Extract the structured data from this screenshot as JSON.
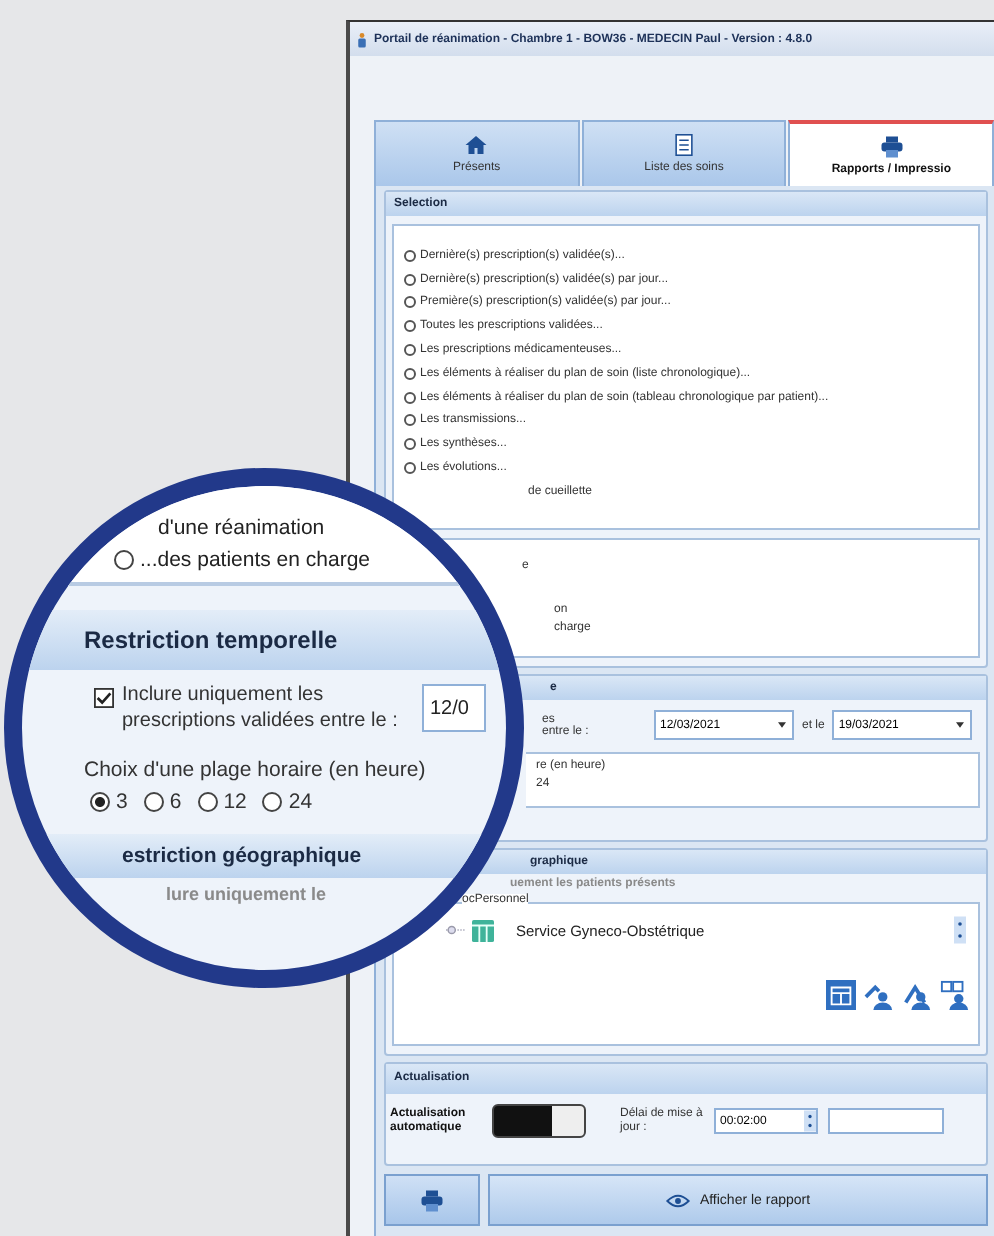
{
  "window": {
    "title": "Portail de réanimation - Chambre 1 - BOW36 - MEDECIN Paul - Version : 4.8.0"
  },
  "tabs": [
    {
      "label": "Présents",
      "selected": false
    },
    {
      "label": "Liste des soins",
      "selected": false
    },
    {
      "label": "Rapports / Impressio",
      "selected": true
    }
  ],
  "selection": {
    "header": "Selection",
    "options": [
      {
        "kind": "full",
        "label": "Dernière(s) prescription(s) validée(s)...",
        "selected": false
      },
      {
        "kind": "full",
        "label": "Dernière(s) prescription(s) validée(s) par jour...",
        "selected": false
      },
      {
        "kind": "full",
        "label": "Première(s) prescription(s) validée(s) par jour...",
        "selected": false
      },
      {
        "kind": "full",
        "label": "Toutes les prescriptions validées...",
        "selected": false
      },
      {
        "kind": "full",
        "label": "Les prescriptions médicamenteuses...",
        "selected": false
      },
      {
        "kind": "full",
        "label": "Les éléments à réaliser du plan de soin (liste chronologique)...",
        "selected": false
      },
      {
        "kind": "full",
        "label": "Les éléments à réaliser du plan de soin (tableau chronologique par patient)...",
        "selected": false
      },
      {
        "kind": "full",
        "label": "Les transmissions...",
        "selected": false
      },
      {
        "kind": "full",
        "label": "Les synthèses...",
        "selected": false
      },
      {
        "kind": "full",
        "label": "Les évolutions...",
        "selected": false
      },
      {
        "kind": "partial",
        "label": "de cueillette"
      }
    ],
    "scope_fragments": [
      "e",
      "on",
      "charge"
    ]
  },
  "temporal": {
    "header_fragment": "e",
    "label_fragments": [
      "es",
      "entre le :"
    ],
    "date_from": "12/03/2021",
    "and_label": "et le",
    "date_to": "19/03/2021",
    "range_fragment": "re (en heure)",
    "option_fragment": "24"
  },
  "geographic": {
    "header_fragment": "graphique",
    "checkbox_fragment": "uement les patients présents",
    "legend_fragment": "ocPersonnel",
    "tree_item": "Service Gyneco-Obstétrique"
  },
  "refresh": {
    "header": "Actualisation",
    "auto_label": "Actualisation automatique",
    "auto_on": true,
    "delay_label": "Délai de mise à jour :",
    "delay": "00:02:00"
  },
  "actions": {
    "report_button": "Afficher le rapport"
  },
  "magnifier": {
    "top_fragment": "d'une réanimation",
    "patients_option": "...des patients en charge",
    "patients_selected": false,
    "temporal_header": "Restriction temporelle",
    "checkbox": {
      "label": "Inclure uniquement les prescriptions validées entre le :",
      "checked": true
    },
    "date_fragment": "12/0",
    "range_legend": "Choix d'une plage horaire (en heure)",
    "ranges": [
      {
        "label": "3",
        "selected": true
      },
      {
        "label": "6",
        "selected": false
      },
      {
        "label": "12",
        "selected": false
      },
      {
        "label": "24",
        "selected": false
      }
    ],
    "geo_header_fragment": "estriction géographique",
    "geo_fragment": "lure uniquement le"
  }
}
